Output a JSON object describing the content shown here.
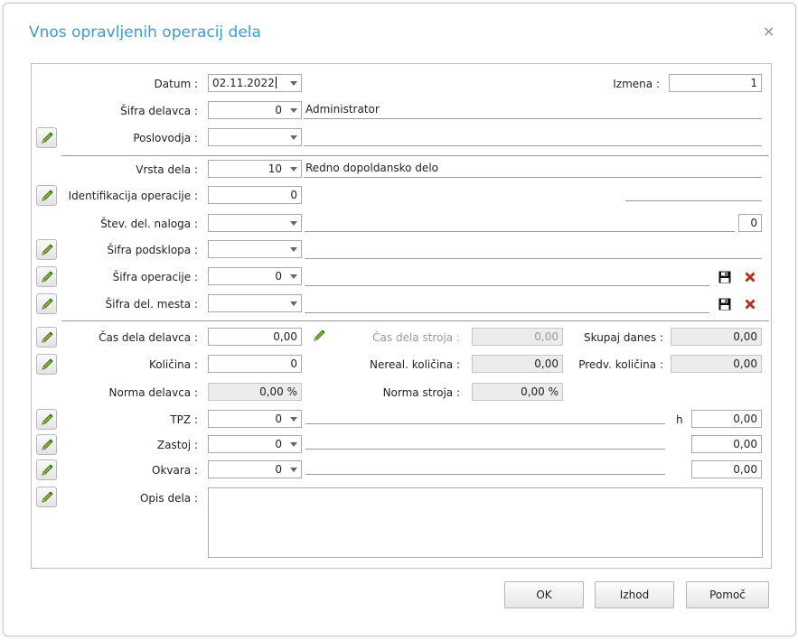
{
  "window": {
    "title": "Vnos opravljenih operacij dela",
    "close_glyph": "×"
  },
  "header": {
    "datum_label": "Datum :",
    "datum_value": "02.11.2022",
    "izmena_label": "Izmena :",
    "izmena_value": "1",
    "sifra_delavca_label": "Šifra delavca :",
    "sifra_delavca_value": "0",
    "sifra_delavca_name": "Administrator",
    "poslovodja_label": "Poslovodja :",
    "poslovodja_value": "",
    "poslovodja_name": ""
  },
  "work": {
    "vrsta_dela_label": "Vrsta dela :",
    "vrsta_dela_value": "10",
    "vrsta_dela_name": "Redno dopoldansko delo",
    "identifikacija_label": "Identifikacija operacije :",
    "identifikacija_value": "0",
    "stev_naloga_label": "Štev. del. naloga :",
    "stev_naloga_value": "",
    "stev_naloga_count": "0",
    "sifra_podsklopa_label": "Šifra podsklopa :",
    "sifra_podsklopa_value": "",
    "sifra_operacije_label": "Šifra operacije :",
    "sifra_operacije_value": "0",
    "sifra_mesta_label": "Šifra del. mesta :",
    "sifra_mesta_value": ""
  },
  "times": {
    "cas_delavca_label": "Čas dela delavca :",
    "cas_delavca_value": "0,00",
    "cas_stroja_label": "Čas dela stroja :",
    "cas_stroja_value": "0,00",
    "skupaj_danes_label": "Skupaj danes :",
    "skupaj_danes_value": "0,00",
    "kolicina_label": "Količina :",
    "kolicina_value": "0",
    "nereal_label": "Nereal. količina :",
    "nereal_value": "0,00",
    "predv_label": "Predv. količina :",
    "predv_value": "0,00",
    "norma_delavca_label": "Norma delavca :",
    "norma_delavca_value": "0,00 %",
    "norma_stroja_label": "Norma stroja :",
    "norma_stroja_value": "0,00 %",
    "tpz_label": "TPZ :",
    "tpz_value": "0",
    "tpz_unit": "h",
    "tpz_hours": "0,00",
    "zastoj_label": "Zastoj :",
    "zastoj_value": "0",
    "zastoj_hours": "0,00",
    "okvara_label": "Okvara :",
    "okvara_value": "0",
    "okvara_hours": "0,00",
    "opis_label": "Opis dela :",
    "opis_value": ""
  },
  "buttons": {
    "ok": "OK",
    "izhod": "Izhod",
    "pomoc": "Pomoč"
  },
  "icons": {
    "edit": "pencil-icon",
    "save": "floppy-disk-icon",
    "delete": "red-x-icon"
  },
  "colors": {
    "title": "#3d9ad9",
    "pencil": "#6aa420",
    "delete": "#d0301f"
  }
}
